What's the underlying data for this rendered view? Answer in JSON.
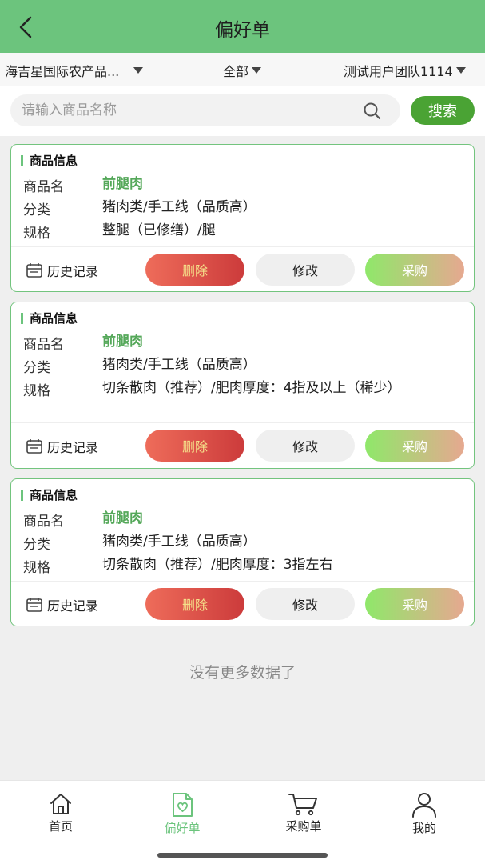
{
  "header": {
    "title": "偏好单"
  },
  "filters": {
    "market": "海吉星国际农产品...",
    "category": "全部",
    "user": "测试用户团队1114"
  },
  "search": {
    "placeholder": "请输入商品名称",
    "button_label": "搜索"
  },
  "cards": [
    {
      "section_title": "商品信息",
      "name_label": "商品名",
      "name": "前腿肉",
      "category_label": "分类",
      "category": "猪肉类/手工线（品质高）",
      "spec_label": "规格",
      "spec": "整腿（已修缮）/腿",
      "history_label": "历史记录",
      "delete_label": "删除",
      "edit_label": "修改",
      "buy_label": "采购"
    },
    {
      "section_title": "商品信息",
      "name_label": "商品名",
      "name": "前腿肉",
      "category_label": "分类",
      "category": "猪肉类/手工线（品质高）",
      "spec_label": "规格",
      "spec": "切条散肉（推荐）/肥肉厚度：4指及以上（稀少）",
      "history_label": "历史记录",
      "delete_label": "删除",
      "edit_label": "修改",
      "buy_label": "采购"
    },
    {
      "section_title": "商品信息",
      "name_label": "商品名",
      "name": "前腿肉",
      "category_label": "分类",
      "category": "猪肉类/手工线（品质高）",
      "spec_label": "规格",
      "spec": "切条散肉（推荐）/肥肉厚度：3指左右",
      "history_label": "历史记录",
      "delete_label": "删除",
      "edit_label": "修改",
      "buy_label": "采购"
    }
  ],
  "footer_note": "没有更多数据了",
  "tabs": [
    {
      "label": "首页",
      "icon": "home-icon"
    },
    {
      "label": "偏好单",
      "icon": "preference-list-icon",
      "active": true
    },
    {
      "label": "采购单",
      "icon": "cart-icon"
    },
    {
      "label": "我的",
      "icon": "person-icon"
    }
  ],
  "colors": {
    "accent": "#6cc47d",
    "search_button": "#4aa334",
    "delete": "#d9473f",
    "buy": "#8fe86a"
  }
}
